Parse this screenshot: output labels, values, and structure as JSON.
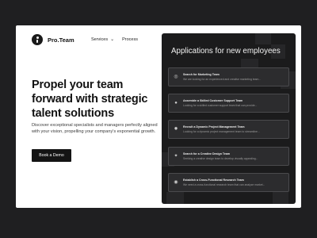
{
  "brand": {
    "name": "Pro.Team",
    "logo_icon": "person-circle-icon"
  },
  "nav": {
    "items": [
      {
        "label": "Services",
        "icon": "chevron-down-icon"
      },
      {
        "label": "Process"
      }
    ]
  },
  "hero": {
    "title": "Propel your team forward with strategic talent solutions",
    "description": "Discover exceptional specialists and managers perfectly aligned with your vision, propelling your company's exponential growth.",
    "cta_label": "Book a Demo"
  },
  "panel": {
    "title": "Applications for new employees",
    "applications": [
      {
        "title": "Search for Marketing Team",
        "subtitle": "We are looking for an experienced and creative marketing team...",
        "icon": "globe-icon"
      },
      {
        "title": "Assemble a Skilled Customer Support Team",
        "subtitle": "Looking for a skilled customer support team that can provide...",
        "icon": "network-icon"
      },
      {
        "title": "Recruit a Dynamic Project Management Team",
        "subtitle": "Looking for a dynamic project management team to streamline...",
        "icon": "star-burst-icon"
      },
      {
        "title": "Search for a Creative Design Team",
        "subtitle": "Seeking a creative design team to develop visually appealing...",
        "icon": "sparkle-icon"
      },
      {
        "title": "Establish a Cross-Functional Research Team",
        "subtitle": "We need a cross-functional research team that can analyze market...",
        "icon": "compass-icon"
      }
    ]
  },
  "colors": {
    "page_bg": "#1f1f21",
    "panel_bg": "#1b1b1c",
    "card_bg": "#2c2c2e",
    "cta_bg": "#141414"
  }
}
